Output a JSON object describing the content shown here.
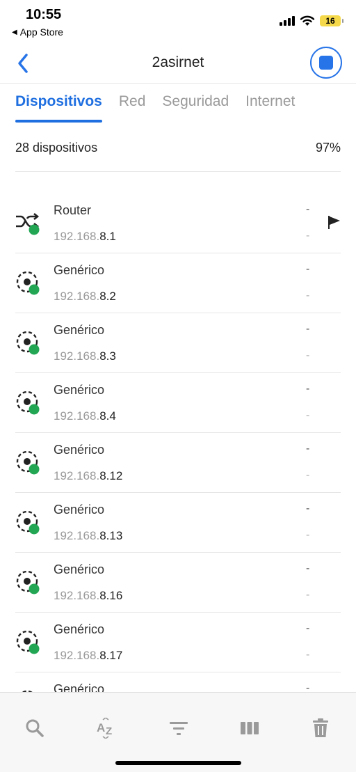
{
  "status_bar": {
    "time": "10:55",
    "back_app": "App Store",
    "battery": "16"
  },
  "nav": {
    "title": "2asirnet",
    "back_icon": "chevron-left-icon",
    "action_icon": "stop-icon",
    "accent": "#2774e8"
  },
  "tabs": [
    {
      "label": "Dispositivos",
      "active": true
    },
    {
      "label": "Red",
      "active": false
    },
    {
      "label": "Seguridad",
      "active": false
    },
    {
      "label": "Internet",
      "active": false
    }
  ],
  "summary": {
    "count": "28 dispositivos",
    "percent": "97%"
  },
  "devices": [
    {
      "name": "Router",
      "ip_prefix": "192.168.",
      "ip_suffix": "8.1",
      "col1": "-",
      "col2": "-",
      "type": "router",
      "flag": true
    },
    {
      "name": "Genérico",
      "ip_prefix": "192.168.",
      "ip_suffix": "8.2",
      "col1": "-",
      "col2": "-",
      "type": "generic",
      "flag": false
    },
    {
      "name": "Genérico",
      "ip_prefix": "192.168.",
      "ip_suffix": "8.3",
      "col1": "-",
      "col2": "-",
      "type": "generic",
      "flag": false
    },
    {
      "name": "Genérico",
      "ip_prefix": "192.168.",
      "ip_suffix": "8.4",
      "col1": "-",
      "col2": "-",
      "type": "generic",
      "flag": false
    },
    {
      "name": "Genérico",
      "ip_prefix": "192.168.",
      "ip_suffix": "8.12",
      "col1": "-",
      "col2": "-",
      "type": "generic",
      "flag": false
    },
    {
      "name": "Genérico",
      "ip_prefix": "192.168.",
      "ip_suffix": "8.13",
      "col1": "-",
      "col2": "-",
      "type": "generic",
      "flag": false
    },
    {
      "name": "Genérico",
      "ip_prefix": "192.168.",
      "ip_suffix": "8.16",
      "col1": "-",
      "col2": "-",
      "type": "generic",
      "flag": false
    },
    {
      "name": "Genérico",
      "ip_prefix": "192.168.",
      "ip_suffix": "8.17",
      "col1": "-",
      "col2": "-",
      "type": "generic",
      "flag": false
    },
    {
      "name": "Genérico",
      "ip_prefix": "",
      "ip_suffix": "",
      "col1": "-",
      "col2": "",
      "type": "generic",
      "flag": false
    }
  ],
  "toolbar": {
    "icons": [
      "search-icon",
      "sort-az-icon",
      "filter-icon",
      "columns-icon",
      "trash-icon"
    ]
  },
  "colors": {
    "online": "#22a654",
    "accent": "#1f6fe0"
  }
}
